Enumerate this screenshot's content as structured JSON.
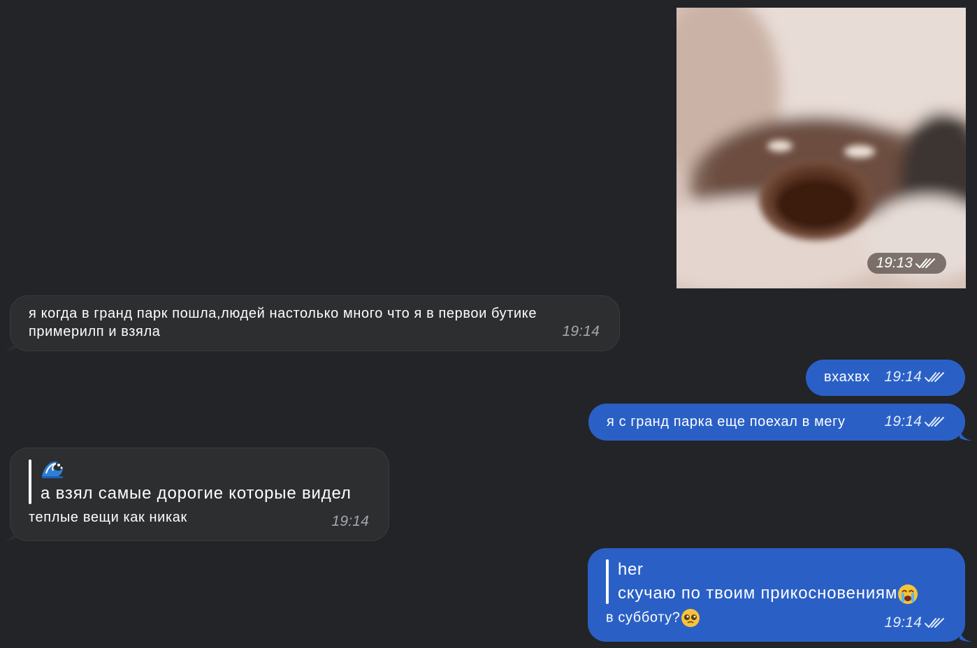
{
  "photo": {
    "time": "19:13",
    "read": true
  },
  "messages": [
    {
      "id": "m1",
      "direction": "in",
      "text": "я когда в гранд парк пошла,людей настолько много что я в первои бутике примерилп и взяла",
      "time": "19:14"
    },
    {
      "id": "m2",
      "direction": "out",
      "text": "вхахвх",
      "time": "19:14",
      "read": true
    },
    {
      "id": "m3",
      "direction": "out",
      "text": "я с гранд парка еще поехал в мегу",
      "time": "19:14",
      "read": true
    },
    {
      "id": "m4",
      "direction": "in",
      "reply_emoji": "wave-emoji",
      "reply_text": "а взял самые дорогие которые видел",
      "text": "теплые вещи как никак",
      "time": "19:14"
    },
    {
      "id": "m5",
      "direction": "out",
      "reply_title": "her",
      "reply_text": "скучаю по твоим прикосновениям",
      "reply_emoji": "loudly-crying-face-emoji",
      "text": "в субботу?",
      "text_emoji": "pleading-face-emoji",
      "time": "19:14",
      "read": true
    }
  ],
  "colors": {
    "background": "#222427",
    "incoming_bubble": "#2d2e30",
    "outgoing_bubble": "#2a60c6",
    "incoming_time": "#a4a7ad"
  }
}
